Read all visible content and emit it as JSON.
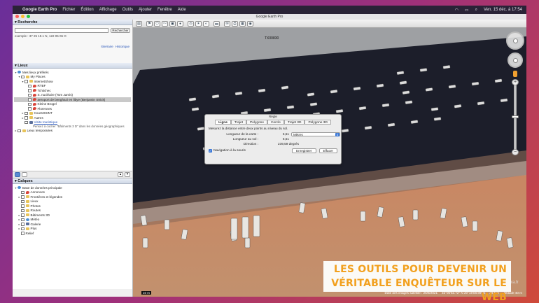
{
  "menubar": {
    "apple": "",
    "app": "Google Earth Pro",
    "items": [
      "Fichier",
      "Édition",
      "Affichage",
      "Outils",
      "Ajouter",
      "Fenêtre",
      "Aide"
    ],
    "datetime": "Ven. 15 déc. à 17:54"
  },
  "window": {
    "title": "Google Earth Pro"
  },
  "search": {
    "header": "Recherche",
    "placeholder": "",
    "button": "Rechercher",
    "coords": "exemple : 37 25 19.1 N, 122 05 06 O",
    "link1": "Itinéraire",
    "link2": "Historique"
  },
  "places": {
    "header": "Lieux",
    "items": [
      {
        "label": "Mes lieux préférés"
      },
      {
        "label": "My Places"
      },
      {
        "label": "InternetShow"
      },
      {
        "label": "RTBF"
      },
      {
        "label": "Tchitchec"
      },
      {
        "label": "S. nucléaire (Tom Jarvis)"
      },
      {
        "label": "aeroport de benghazi en libye (Benjamin Strick)"
      },
      {
        "label": "Kleine Brogel"
      },
      {
        "label": "Florennes"
      },
      {
        "label": "CoursOSINT"
      },
      {
        "label": "Autres"
      },
      {
        "label": "Visite touristique"
      },
      {
        "label": "Pensez à cocher \"Bâtiments 3 D\" dans les données géographiques"
      },
      {
        "label": "Lieux temporaires"
      }
    ]
  },
  "layers": {
    "header": "Calques",
    "items": [
      {
        "label": "Base de données principale"
      },
      {
        "label": "Annonces"
      },
      {
        "label": "Frontières et légendes"
      },
      {
        "label": "Lieux"
      },
      {
        "label": "Photos"
      },
      {
        "label": "Routes"
      },
      {
        "label": "Bâtiments 3D"
      },
      {
        "label": "Météo"
      },
      {
        "label": "Galerie"
      },
      {
        "label": "Plus"
      },
      {
        "label": "Relief"
      }
    ]
  },
  "ruler": {
    "title": "Règle",
    "tabs": [
      "Ligne",
      "Trajet",
      "Polygone",
      "Cercle",
      "Trajet 3D",
      "Polygone 3D"
    ],
    "active_tab": "Ligne",
    "description": "Mesurez la distance entre deux points au niveau du sol.",
    "map_length_label": "Longueur de la carte :",
    "map_length_value": "6,51",
    "unit": "Mètres",
    "ground_length_label": "Longueur au sol :",
    "ground_length_value": "6,51",
    "heading_label": "Direction :",
    "heading_value": "239,59 degrés",
    "mouse_nav_label": "Navigation à la souris",
    "save_button": "Enregistrer",
    "clear_button": "Effacer"
  },
  "map": {
    "label_hangar": "TX00830",
    "status_credit": "Date des images satellite : 26/9/2021",
    "status_coords": "32°05'53.72\" N   20°16'08.98\" E",
    "status_alt": "alt 5 m",
    "status_view": "Altitude 40 m",
    "scale": "10 m"
  },
  "overlay": {
    "line1": "LES OUTILS POUR DEVENIR UN",
    "line2": "VÉRITABLE ENQUÊTEUR SUR LE WEB",
    "watermark": "ra.fr"
  },
  "colors": {
    "tarmac": "#1c1e2a",
    "sand": "#c8805a",
    "accent": "#f2a01e"
  }
}
